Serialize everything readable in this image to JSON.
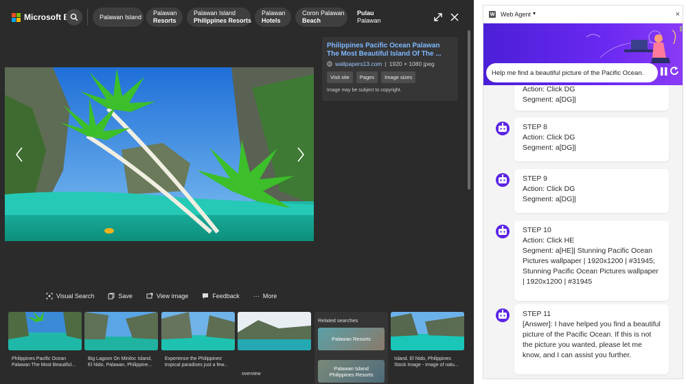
{
  "bing": {
    "brand": "Microsoft Bing",
    "colors": {
      "ms_red": "#f25022",
      "ms_green": "#7fba00",
      "ms_blue": "#00a4ef",
      "ms_yellow": "#ffb900",
      "link": "#7fb8ff",
      "background": "#2b2b2b"
    },
    "chips": [
      {
        "line1": "Palawan Island",
        "line2": ""
      },
      {
        "line1": "Palawan",
        "line2": "Resorts"
      },
      {
        "line1": "Palawan Island",
        "line2": "Philippines Resorts"
      },
      {
        "line1": "Palawan",
        "line2": "Hotels"
      },
      {
        "line1": "Coron Palawan",
        "line2": "Beach"
      },
      {
        "line1": "Pulau",
        "line2": "Palawan"
      }
    ],
    "icons": {
      "search": "search-icon",
      "expand": "expand-icon",
      "close": "close-icon",
      "prev": "chevron-left-icon",
      "next": "chevron-right-icon"
    },
    "info": {
      "title": "Philippines Pacific Ocean Palawan The Most Beautiful Island Of The ...",
      "source": "wallpapers13.com",
      "separator": "|",
      "dims": "1920 × 1080 jpeg",
      "buttons": [
        "Visit site",
        "Pages",
        "Image sizes"
      ],
      "note": "Image may be subject to copyright."
    },
    "actions": [
      {
        "label": "Visual Search",
        "icon": "visual-search-icon"
      },
      {
        "label": "Save",
        "icon": "save-icon"
      },
      {
        "label": "View image",
        "icon": "view-image-icon"
      },
      {
        "label": "Feedback",
        "icon": "feedback-icon"
      },
      {
        "label": "More",
        "icon": "more-icon"
      }
    ],
    "thumbs": [
      {
        "caption1": "Philippines Pacific Ocean",
        "caption2": "Palawan The Most Beautiful..."
      },
      {
        "caption1": "Big Lagoon On Miniloc Island,",
        "caption2": "El Nido, Palawan, Philippine..."
      },
      {
        "caption1": "Experience the Philippines'",
        "caption2": "tropical paradises just a few..."
      },
      {
        "caption1": "overview",
        "caption2": ""
      },
      {
        "caption1": "Island. El Nido, Philippines",
        "caption2": "Stock Image - Image of natu..."
      }
    ],
    "related": {
      "title": "Related searches",
      "items": [
        {
          "line1": "Palawan Resorts",
          "line2": ""
        },
        {
          "line1": "Palawan Island",
          "line2": "Philippines Resorts"
        }
      ]
    }
  },
  "agent": {
    "name": "Web Agent",
    "logo": "W",
    "caret": "▾",
    "close": "×",
    "query": "Help me find a beautiful picture of the Pacific Ocean.",
    "accent": "#5b24e6",
    "steps": [
      {
        "step": "",
        "lines": [
          "Action: Click DG",
          "Segment: a[DG]|"
        ]
      },
      {
        "step": "STEP 8",
        "lines": [
          "Action: Click DG",
          "Segment: a[DG]|"
        ]
      },
      {
        "step": "STEP 9",
        "lines": [
          "Action: Click DG",
          "Segment: a[DG]|"
        ]
      },
      {
        "step": "STEP 10",
        "lines": [
          "Action: Click HE",
          "Segment: a[HE]| Stunning Pacific Ocean Pictures wallpaper | 1920x1200 | #31945; Stunning Pacific Ocean Pictures wallpaper | 1920x1200 | #31945"
        ]
      },
      {
        "step": "STEP 11",
        "lines": [
          "[Answer]: I have helped you find a beautiful picture of the Pacific Ocean. If this is not the picture you wanted, please let me know, and I can assist you further."
        ]
      }
    ]
  }
}
